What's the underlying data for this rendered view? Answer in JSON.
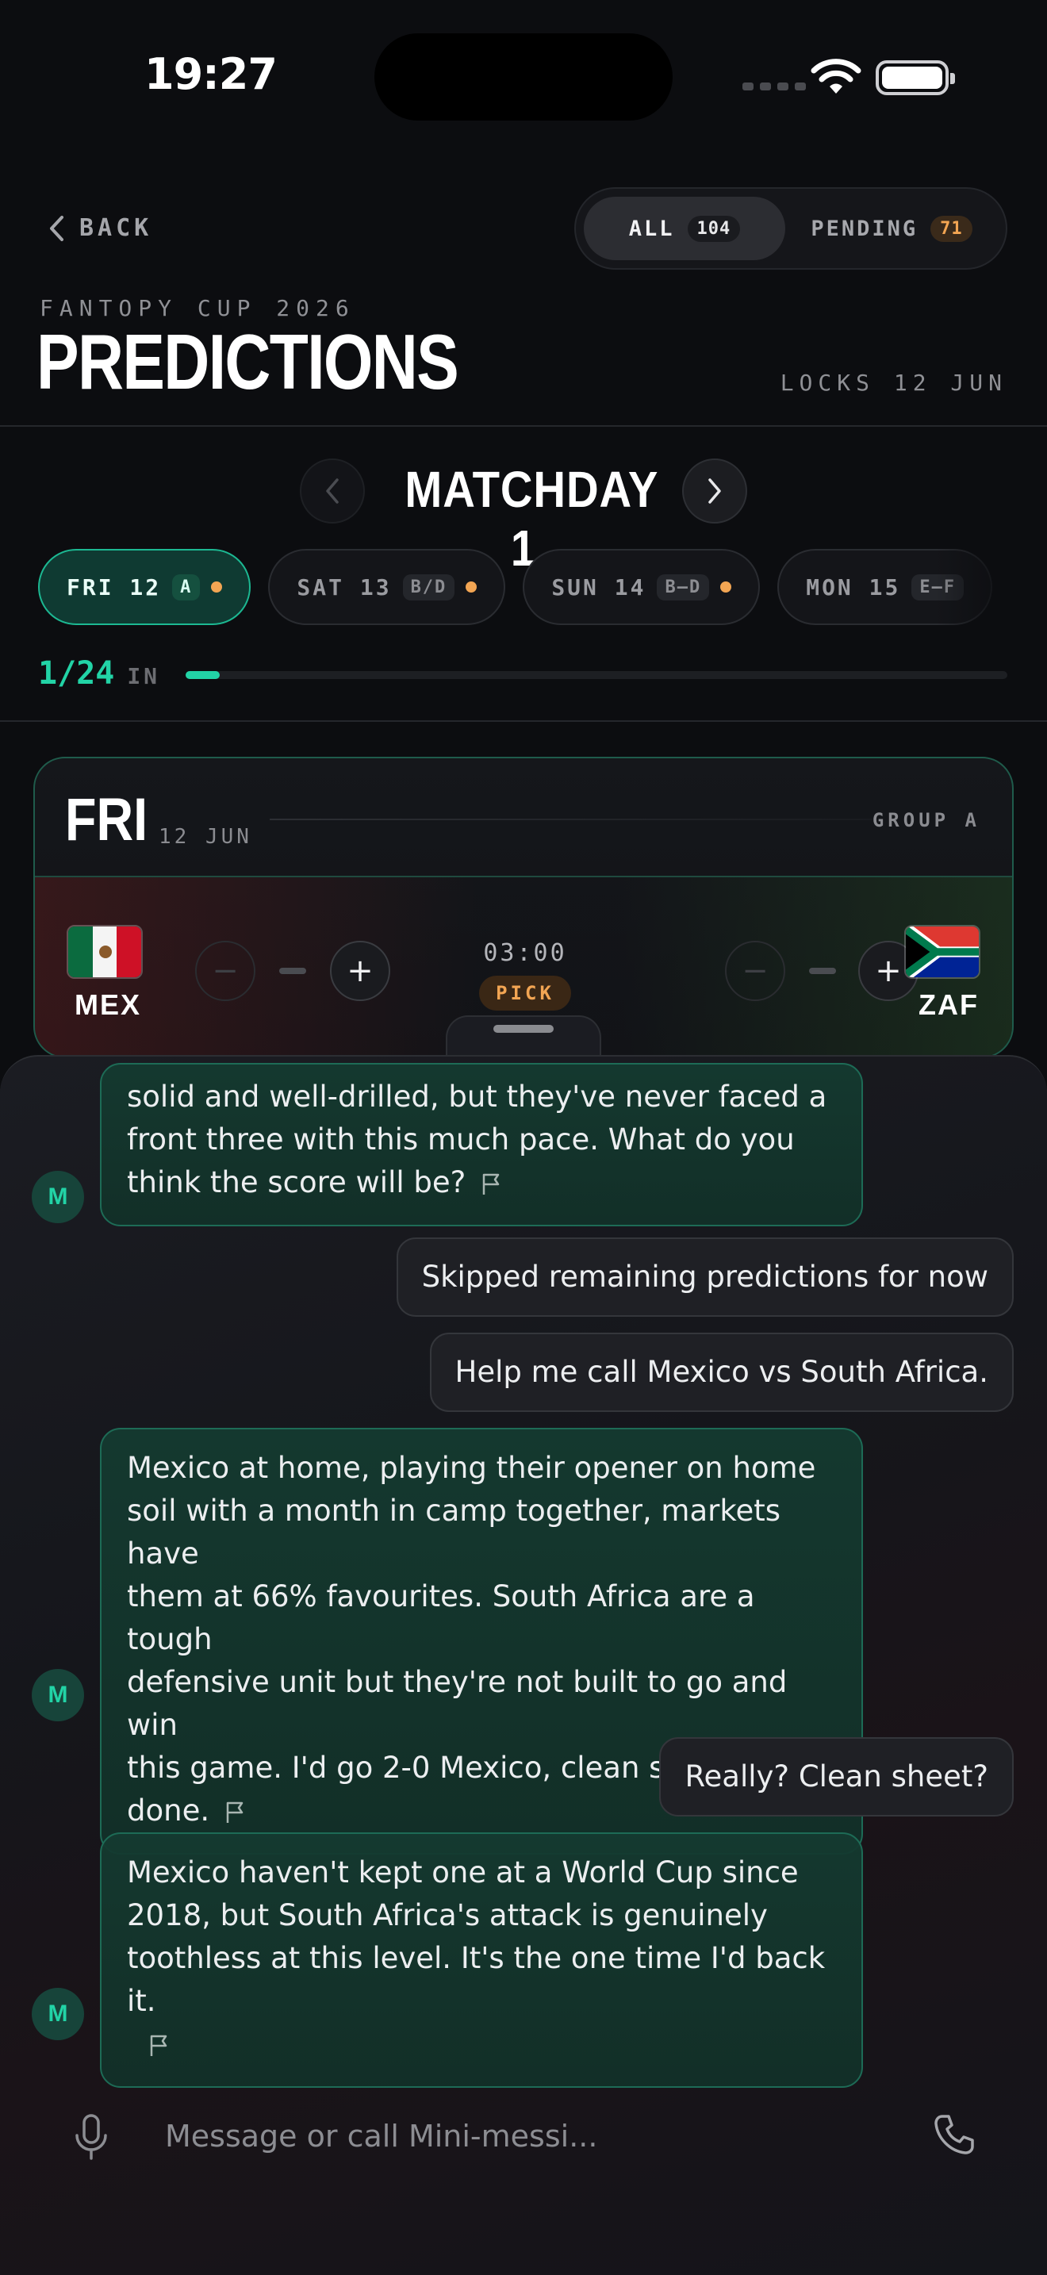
{
  "status": {
    "time": "19:27"
  },
  "header": {
    "back_label": "BACK",
    "filters": [
      {
        "label": "ALL",
        "count": "104",
        "selected": true
      },
      {
        "label": "PENDING",
        "count": "71",
        "selected": false
      }
    ],
    "eyebrow": "FANTOPY CUP 2026",
    "title": "PREDICTIONS",
    "locks": "LOCKS 12 JUN"
  },
  "matchday": {
    "title": "MATCHDAY 1",
    "days": [
      {
        "label": "FRI 12",
        "groups": "A",
        "active": true
      },
      {
        "label": "SAT 13",
        "groups": "B/D",
        "active": false
      },
      {
        "label": "SUN 14",
        "groups": "B–D",
        "active": false
      },
      {
        "label": "MON 15",
        "groups": "E–F",
        "active": false
      }
    ],
    "progress": {
      "count": "1/24",
      "label": "IN",
      "fraction": 0.0417
    }
  },
  "daycard": {
    "day": "FRI",
    "date": "12 JUN",
    "group": "GROUP A",
    "match": {
      "home": {
        "code": "MEX",
        "flag": "mexico-flag"
      },
      "away": {
        "code": "ZAF",
        "flag": "south-africa-flag"
      },
      "kickoff": "03:00",
      "status": "PICK",
      "accent_pending": "#f2a553",
      "accent_primary": "#22d3a6"
    }
  },
  "chat": {
    "avatar_initial": "M",
    "messages": [
      {
        "role": "bot",
        "lines": [
          "solid and well-drilled, but they've never faced a",
          "front three with this much pace. What do you",
          "think the score will be?"
        ]
      },
      {
        "role": "user",
        "text": "Skipped remaining predictions for now"
      },
      {
        "role": "user",
        "text": "Help me call Mexico vs South Africa."
      },
      {
        "role": "bot",
        "lines": [
          "Mexico at home, playing their opener on home",
          "soil with a month in camp together, markets have",
          "them at 66% favourites. South Africa are a tough",
          "defensive unit but they're not built to go and win",
          "this game. I'd go 2-0 Mexico, clean sheet, job",
          "done."
        ]
      },
      {
        "role": "user",
        "text": "Really? Clean sheet?"
      },
      {
        "role": "bot",
        "lines": [
          "Mexico haven't kept one at a World Cup since",
          "2018, but South Africa's attack is genuinely",
          "toothless at this level. It's the one time I'd back it."
        ]
      }
    ],
    "composer": {
      "placeholder": "Message or call Mini-messi..."
    }
  }
}
